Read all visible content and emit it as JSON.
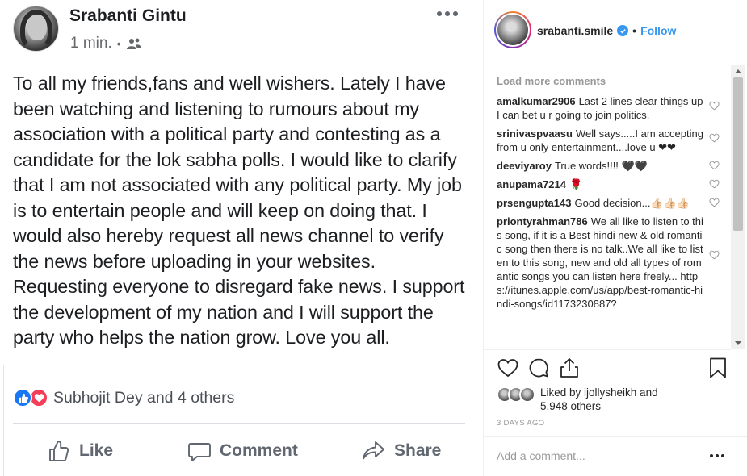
{
  "facebook_post": {
    "author": "Srabanti Gintu",
    "timestamp": "1 min.",
    "separator": "•",
    "privacy_icon": "friends-icon",
    "text": "To all my friends,fans and well wishers. Lately I have been watching and listening to rumours about my association with a political party and contesting as a candidate for the lok sabha polls. I would like to clarify that I am not associated with any political party. My job is to entertain people and will keep on doing that. I would also hereby request all news channel to verify the news before uploading in your websites. Requesting everyone to disregard fake news. I support the development of my nation and I will support the party who helps the nation grow. Love you all.",
    "reactions_text": "Subhojit Dey and 4 others",
    "actions": {
      "like": "Like",
      "comment": "Comment",
      "share": "Share"
    },
    "colors": {
      "like_blue": "#1877f2",
      "love_red": "#f33e58",
      "action_grey": "#606770"
    }
  },
  "instagram_post": {
    "username": "srabanti.smile",
    "verified": true,
    "follow_separator": "•",
    "follow_label": "Follow",
    "load_more": "Load more comments",
    "comments": [
      {
        "user": "amalkumar2906",
        "text": "Last 2 lines clear things up I can bet u r going to join politics."
      },
      {
        "user": "srinivaspvaasu",
        "text": "Well says.....I am accepting from u only entertainment....love u ❤❤"
      },
      {
        "user": "deeviyaroy",
        "text": "True words!!!! 🖤🖤"
      },
      {
        "user": "anupama7214",
        "text": "🌹"
      },
      {
        "user": "prsengupta143",
        "text": "Good decision...👍🏻👍🏻👍🏻"
      },
      {
        "user": "priontyrahman786",
        "text": "We all like to listen to this song, if it is a Best hindi new & old romantic song then there is no talk..We all like to listen to this song, new and old all types of romantic songs you can listen here freely... https://itunes.apple.com/us/app/best-romantic-hindi-songs/id1173230887?"
      }
    ],
    "liked_by_text": "Liked by ijollysheikh and 5,948 others",
    "date": "3 DAYS AGO",
    "add_comment_placeholder": "Add a comment...",
    "colors": {
      "link_blue": "#3897f0",
      "muted": "#999999"
    }
  }
}
